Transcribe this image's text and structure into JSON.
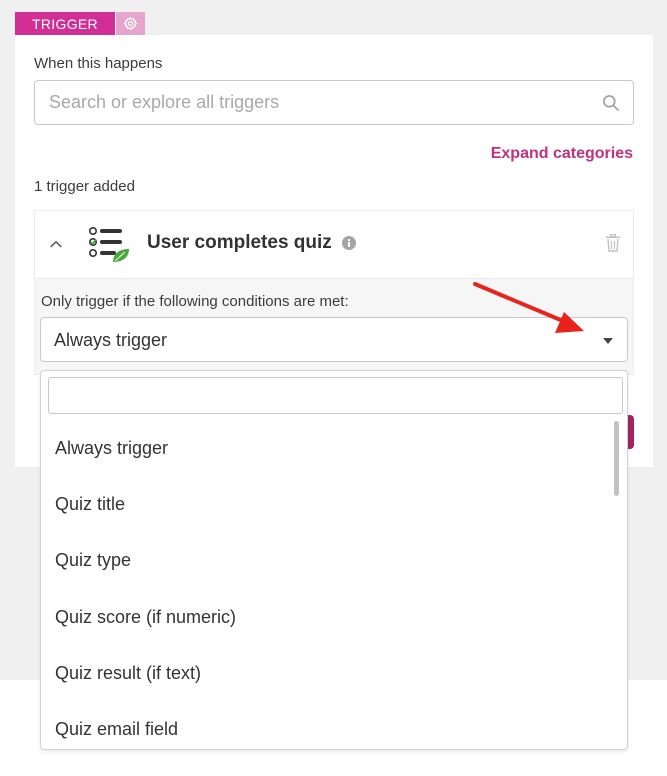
{
  "tabs": {
    "trigger_label": "TRIGGER"
  },
  "card": {
    "section_label": "When this happens",
    "search_placeholder": "Search or explore all triggers",
    "expand_link": "Expand categories",
    "added_count": "1 trigger added"
  },
  "trigger_item": {
    "title": "User completes quiz",
    "conditions_label": "Only trigger if the following conditions are met:",
    "selected_condition": "Always trigger"
  },
  "dropdown": {
    "options": [
      "Always trigger",
      "Quiz title",
      "Quiz type",
      "Quiz score (if numeric)",
      "Quiz result (if text)",
      "Quiz email field"
    ]
  },
  "colors": {
    "accent": "#d12e96",
    "link": "#c2307f",
    "annotation_arrow": "#e8231d"
  },
  "icons": [
    "gear-icon",
    "search-icon",
    "chevron-up-icon",
    "quiz-checklist-icon",
    "info-icon",
    "trash-icon",
    "caret-down-icon"
  ]
}
